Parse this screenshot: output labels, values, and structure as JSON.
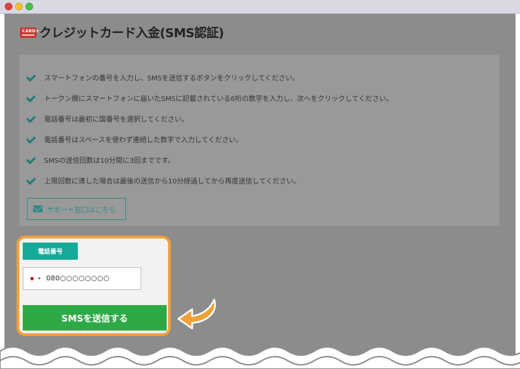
{
  "window": {
    "controls": [
      "close",
      "minimize",
      "maximize"
    ]
  },
  "page": {
    "title": "クレジットカード入金(SMS認証)",
    "card_icon_text": "CARD+"
  },
  "instructions": [
    "スマートフォンの番号を入力し、SMSを送信するボタンをクリックしてください。",
    "トークン欄にスマートフォンに届いたSMSに記載されている6桁の数字を入力し、次へをクリックしてください。",
    "電話番号は最初に国番号を選択してください。",
    "電話番号はスペースを使わず連続した数字で入力してください。",
    "SMSの送信回数は10分間に3回までです。",
    "上限回数に達した場合は最後の送信から10分経過してから再度送信してください。"
  ],
  "support": {
    "label": "サポート窓口はこちら",
    "icon": "mail-icon"
  },
  "phone": {
    "label": "電話番号",
    "value": "080○○○○○○○○",
    "country_flag": "japan-flag-icon"
  },
  "sms_button": {
    "label": "SMSを送信する"
  },
  "colors": {
    "accent_teal": "#16aa99",
    "button_green": "#2daa46",
    "highlight_orange": "#f0a13a",
    "check_teal": "#1f7a72"
  }
}
